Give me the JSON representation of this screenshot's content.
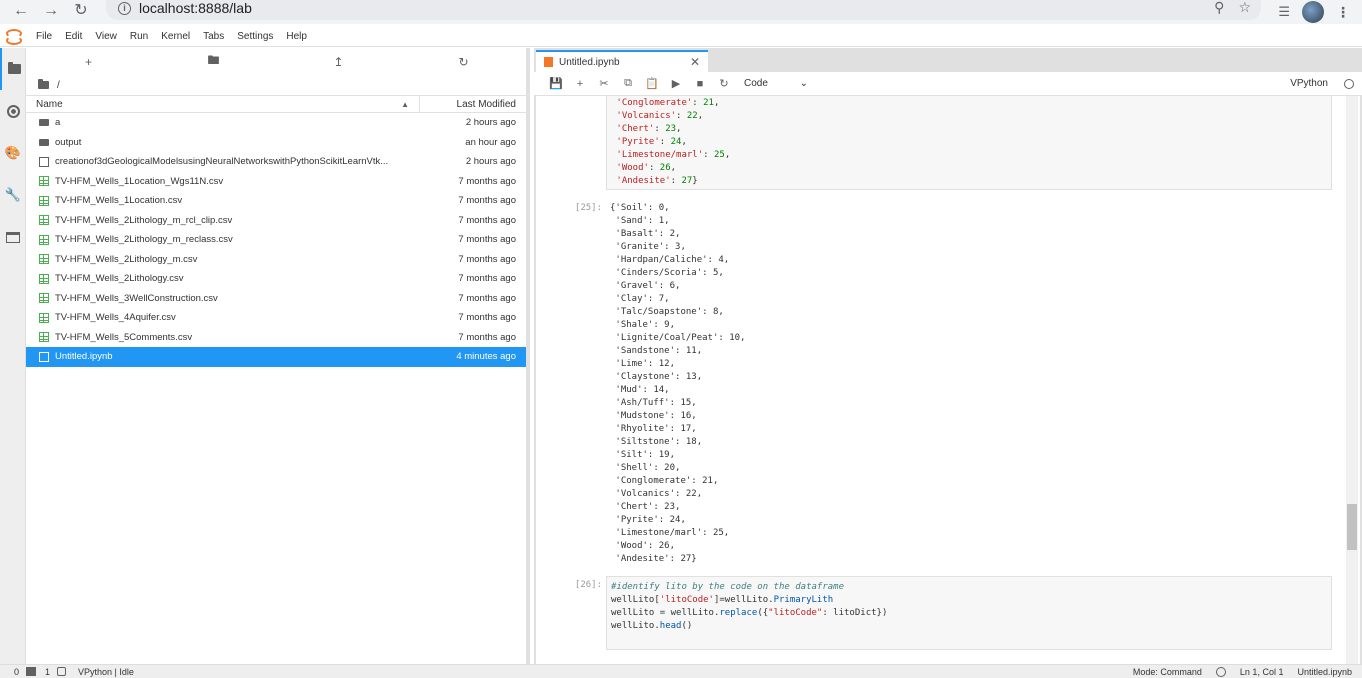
{
  "browser": {
    "url": "localhost:8888/lab",
    "back_icon": "arrow-left-icon",
    "forward_icon": "arrow-right-icon",
    "reload_icon": "reload-icon"
  },
  "menu": [
    "File",
    "Edit",
    "View",
    "Run",
    "Kernel",
    "Tabs",
    "Settings",
    "Help"
  ],
  "filebrowser": {
    "breadcrumb": "/",
    "col_name": "Name",
    "col_modified": "Last Modified",
    "items": [
      {
        "name": "a",
        "type": "folder",
        "modified": "2 hours ago"
      },
      {
        "name": "output",
        "type": "folder",
        "modified": "an hour ago"
      },
      {
        "name": "creationof3dGeologicalModelsusingNeuralNetworkswithPythonScikitLearnVtk...",
        "type": "file",
        "modified": "2 hours ago"
      },
      {
        "name": "TV-HFM_Wells_1Location_Wgs11N.csv",
        "type": "csv",
        "modified": "7 months ago"
      },
      {
        "name": "TV-HFM_Wells_1Location.csv",
        "type": "csv",
        "modified": "7 months ago"
      },
      {
        "name": "TV-HFM_Wells_2Lithology_m_rcl_clip.csv",
        "type": "csv",
        "modified": "7 months ago"
      },
      {
        "name": "TV-HFM_Wells_2Lithology_m_reclass.csv",
        "type": "csv",
        "modified": "7 months ago"
      },
      {
        "name": "TV-HFM_Wells_2Lithology_m.csv",
        "type": "csv",
        "modified": "7 months ago"
      },
      {
        "name": "TV-HFM_Wells_2Lithology.csv",
        "type": "csv",
        "modified": "7 months ago"
      },
      {
        "name": "TV-HFM_Wells_3WellConstruction.csv",
        "type": "csv",
        "modified": "7 months ago"
      },
      {
        "name": "TV-HFM_Wells_4Aquifer.csv",
        "type": "csv",
        "modified": "7 months ago"
      },
      {
        "name": "TV-HFM_Wells_5Comments.csv",
        "type": "csv",
        "modified": "7 months ago"
      },
      {
        "name": "Untitled.ipynb",
        "type": "notebook",
        "modified": "4 minutes ago",
        "selected": true
      }
    ]
  },
  "notebook": {
    "tab_title": "Untitled.ipynb",
    "cell_type": "Code",
    "kernel": "VPython",
    "prev_output_tail": [
      [
        "'Conglomerate'",
        "21",
        ","
      ],
      [
        "'Volcanics'",
        "22",
        ","
      ],
      [
        "'Chert'",
        "23",
        ","
      ],
      [
        "'Pyrite'",
        "24",
        ","
      ],
      [
        "'Limestone/marl'",
        "25",
        ","
      ],
      [
        "'Wood'",
        "26",
        ","
      ],
      [
        "'Andesite'",
        "27",
        "}"
      ]
    ],
    "out25_prompt": "[25]:",
    "out25_lines": [
      "{'Soil': 0,",
      " 'Sand': 1,",
      " 'Basalt': 2,",
      " 'Granite': 3,",
      " 'Hardpan/Caliche': 4,",
      " 'Cinders/Scoria': 5,",
      " 'Gravel': 6,",
      " 'Clay': 7,",
      " 'Talc/Soapstone': 8,",
      " 'Shale': 9,",
      " 'Lignite/Coal/Peat': 10,",
      " 'Sandstone': 11,",
      " 'Lime': 12,",
      " 'Claystone': 13,",
      " 'Mud': 14,",
      " 'Ash/Tuff': 15,",
      " 'Mudstone': 16,",
      " 'Rhyolite': 17,",
      " 'Siltstone': 18,",
      " 'Silt': 19,",
      " 'Shell': 20,",
      " 'Conglomerate': 21,",
      " 'Volcanics': 22,",
      " 'Chert': 23,",
      " 'Pyrite': 24,",
      " 'Limestone/marl': 25,",
      " 'Wood': 26,",
      " 'Andesite': 27}"
    ],
    "in26_prompt": "[26]:",
    "in26_comment": "#identify lito by the code on the dataframe",
    "in26_line2_a": "wellLito[",
    "in26_line2_str": "'litoCode'",
    "in26_line2_b": "]=wellLito.",
    "in26_line2_attr": "PrimaryLith",
    "in26_line3_a": "wellLito = wellLito.",
    "in26_line3_attr": "replace",
    "in26_line3_b": "({",
    "in26_line3_str": "\"litoCode\"",
    "in26_line3_c": ": litoDict})",
    "in26_line4_a": "wellLito.",
    "in26_line4_attr": "head",
    "in26_line4_b": "()"
  },
  "status": {
    "left_a": "0",
    "left_b": "1",
    "kernel_status": "VPython | Idle",
    "mode": "Mode: Command",
    "position": "Ln 1, Col 1",
    "filename": "Untitled.ipynb"
  }
}
